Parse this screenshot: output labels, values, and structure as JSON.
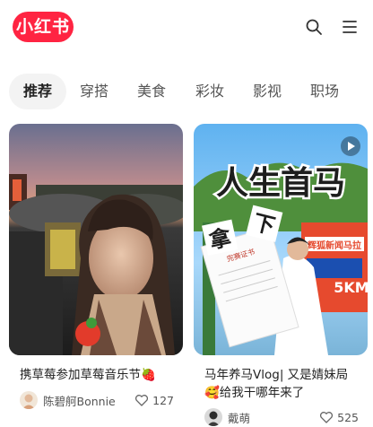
{
  "header": {
    "logo_text": "小红书",
    "brand_color": "#ff2442",
    "icons": [
      "search-icon",
      "menu-icon"
    ]
  },
  "tabs": [
    {
      "label": "推荐",
      "active": true
    },
    {
      "label": "穿搭",
      "active": false
    },
    {
      "label": "美食",
      "active": false
    },
    {
      "label": "彩妆",
      "active": false
    },
    {
      "label": "影视",
      "active": false
    },
    {
      "label": "职场",
      "active": false
    }
  ],
  "feed": [
    {
      "title": "携草莓参加草莓音乐节🍓",
      "author": "陈碧舸Bonnie",
      "likes": "127"
    },
    {
      "title": "马年养马Vlog| 又是婧妹局🥰给我干哪年来了",
      "author": "戴萌",
      "likes": "525",
      "is_video": true,
      "cover_headline": "人生首马",
      "cover_sub_1": "拿",
      "cover_sub_2": "下",
      "cover_cert": "完赛证书",
      "cover_banner": "辉狐新闻马拉",
      "cover_distance": "5KM"
    }
  ]
}
